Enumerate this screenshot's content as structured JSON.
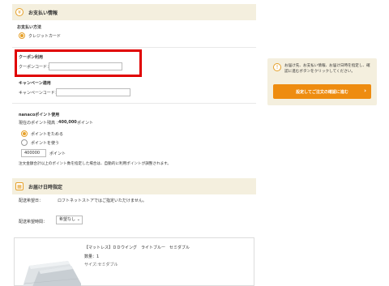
{
  "payment": {
    "section_title": "お支払い情報",
    "method_label": "お支払い方法",
    "method_value": "クレジットカード"
  },
  "coupon": {
    "title": "クーポン利用",
    "code_label": "クーポンコード：",
    "code_value": ""
  },
  "campaign": {
    "title": "キャンペーン適用",
    "code_label": "キャンペーンコード：",
    "code_value": ""
  },
  "nanaco": {
    "title": "nanacoポイント使用",
    "balance_label": "現在のポイント残高 ：",
    "balance_value": "400,000",
    "balance_unit": "ポイント",
    "option_save": "ポイントをためる",
    "option_use": "ポイントを使う",
    "points_value": "400000",
    "points_unit": "ポイント",
    "note": "注文金額合計以上のポイント数を指定した場合は、自動的に利用ポイントが調整されます。"
  },
  "delivery": {
    "section_title": "お届け日時指定",
    "date_label": "配送希望日：",
    "date_value": "ロフトネットストアではご指定いただけません。",
    "time_label": "配送希望時間：",
    "time_value": "希望なし"
  },
  "product": {
    "name": "【マットレス】ＤＤウイング　ライトブルー　セミダブル",
    "quantity": "数量：1",
    "size": "サイズ:セミダブル"
  },
  "sidebar": {
    "notice": "お届け先、お支払い情報、お届け日時を指定し、確認に進むボタンをクリックしてください。",
    "confirm_button": "設定してご注文の確認に進む",
    "confirm_arrow": "›"
  },
  "colors": {
    "accent": "#ee8c10",
    "header_bg": "#f4efde",
    "highlight_border": "#e00000"
  }
}
